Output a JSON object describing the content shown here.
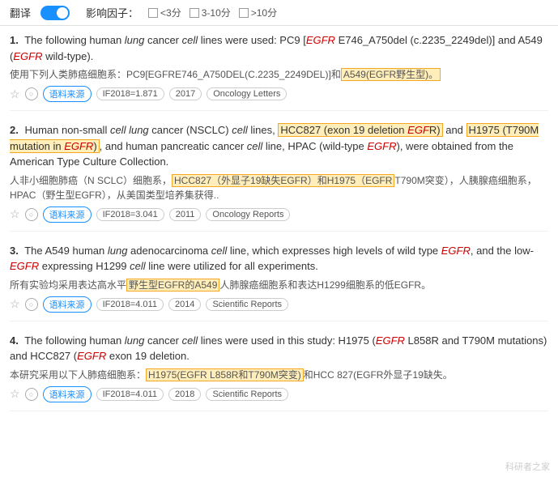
{
  "topbar": {
    "translate_label": "翻译",
    "influence_label": "影响因子：",
    "filter1": "<3分",
    "filter2": "3-10分",
    "filter3": ">10分"
  },
  "results": [
    {
      "number": "1.",
      "en_parts": [
        {
          "text": "The following human ",
          "style": "normal"
        },
        {
          "text": "lung",
          "style": "italic"
        },
        {
          "text": " cancer ",
          "style": "normal"
        },
        {
          "text": "cell",
          "style": "italic"
        },
        {
          "text": " lines were used: PC9 [",
          "style": "normal"
        },
        {
          "text": "EGFR",
          "style": "italic-red"
        },
        {
          "text": " E746_A750del (c.2235_2249del)] and A549 (",
          "style": "normal"
        },
        {
          "text": "EGFR",
          "style": "italic-red"
        },
        {
          "text": " wild-type).",
          "style": "normal"
        }
      ],
      "cn_parts": [
        {
          "text": "使用下列人类肺癌细胞系：PC9[EGFRE746_A750DEL(C.2235_2249DEL)]和",
          "style": "normal"
        },
        {
          "text": "A549(EGFR野生型)。",
          "style": "highlight"
        }
      ],
      "if_value": "IF2018=1.871",
      "year": "2017",
      "journal": "Oncology Letters"
    },
    {
      "number": "2.",
      "en_parts": [
        {
          "text": "Human non-small ",
          "style": "normal"
        },
        {
          "text": "cell lung",
          "style": "italic"
        },
        {
          "text": " cancer (NSCLC) ",
          "style": "normal"
        },
        {
          "text": "cell",
          "style": "italic"
        },
        {
          "text": " lines, ",
          "style": "normal"
        },
        {
          "text": "HCC827 (exon 19 deletion EGF",
          "style": "highlight-start"
        },
        {
          "text": "R)",
          "style": "normal"
        },
        {
          "text": " and ",
          "style": "normal"
        },
        {
          "text": "H1975 (T790M mutation in ",
          "style": "highlight2-start"
        },
        {
          "text": "EGFR",
          "style": "italic-red"
        },
        {
          "text": ")",
          "style": "normal"
        },
        {
          "text": ", and human pancreatic cancer ",
          "style": "normal"
        },
        {
          "text": "cell",
          "style": "italic"
        },
        {
          "text": " line, HPAC (wild-type ",
          "style": "normal"
        },
        {
          "text": "EGFR",
          "style": "italic-red"
        },
        {
          "text": "), were obtained from the American Type Culture Collection.",
          "style": "normal"
        }
      ],
      "cn_parts": [
        {
          "text": "人非小细胞肺癌（N SCLC）细胞系，",
          "style": "normal"
        },
        {
          "text": "HCC827（外显子19缺失EGFR）和H1975（EGFR",
          "style": "highlight"
        },
        {
          "text": "T790M突变），人胰腺癌细胞系，HPAC（野生型EGFR），从美国类型培养集获得..",
          "style": "normal"
        }
      ],
      "if_value": "IF2018=3.041",
      "year": "2011",
      "journal": "Oncology Reports"
    },
    {
      "number": "3.",
      "en_parts": [
        {
          "text": "The A549 human ",
          "style": "normal"
        },
        {
          "text": "lung",
          "style": "italic"
        },
        {
          "text": " adenocarcinoma ",
          "style": "normal"
        },
        {
          "text": "cell",
          "style": "italic"
        },
        {
          "text": " line, which expresses high levels of wild type ",
          "style": "normal"
        },
        {
          "text": "EGFR",
          "style": "italic-red"
        },
        {
          "text": ", and the low-",
          "style": "normal"
        },
        {
          "text": "EGFR",
          "style": "italic-red"
        },
        {
          "text": " expressing H1299 ",
          "style": "normal"
        },
        {
          "text": "cell",
          "style": "italic"
        },
        {
          "text": " line were utilized for all experiments.",
          "style": "normal"
        }
      ],
      "cn_parts": [
        {
          "text": "所有实验均采用表达高水平",
          "style": "normal"
        },
        {
          "text": "野生型EGFR的A549",
          "style": "highlight"
        },
        {
          "text": "人肺腺癌细胞系和表达H1299细胞系的低EGFR。",
          "style": "normal"
        }
      ],
      "if_value": "IF2018=4.011",
      "year": "2014",
      "journal": "Scientific Reports"
    },
    {
      "number": "4.",
      "en_parts": [
        {
          "text": "The following human ",
          "style": "normal"
        },
        {
          "text": "lung",
          "style": "italic"
        },
        {
          "text": " cancer ",
          "style": "normal"
        },
        {
          "text": "cell",
          "style": "italic"
        },
        {
          "text": " lines were used in this study: H1975 (",
          "style": "normal"
        },
        {
          "text": "EGFR",
          "style": "italic-red"
        },
        {
          "text": " L858R and T790M mutations) and HCC827 (",
          "style": "normal"
        },
        {
          "text": "EGFR",
          "style": "italic-red"
        },
        {
          "text": " exon 19 deletion.",
          "style": "normal"
        }
      ],
      "cn_parts": [
        {
          "text": "本研究采用以下人肺癌细胞系：",
          "style": "normal"
        },
        {
          "text": "H1975(EGFR L858R和T790M突变)",
          "style": "highlight"
        },
        {
          "text": "和HCC 827(EGFR外显子19缺失。",
          "style": "normal"
        }
      ],
      "if_value": "IF2018=4.011",
      "year": "2018",
      "journal": "Scientific Reports"
    }
  ],
  "watermark": "科研者之家"
}
